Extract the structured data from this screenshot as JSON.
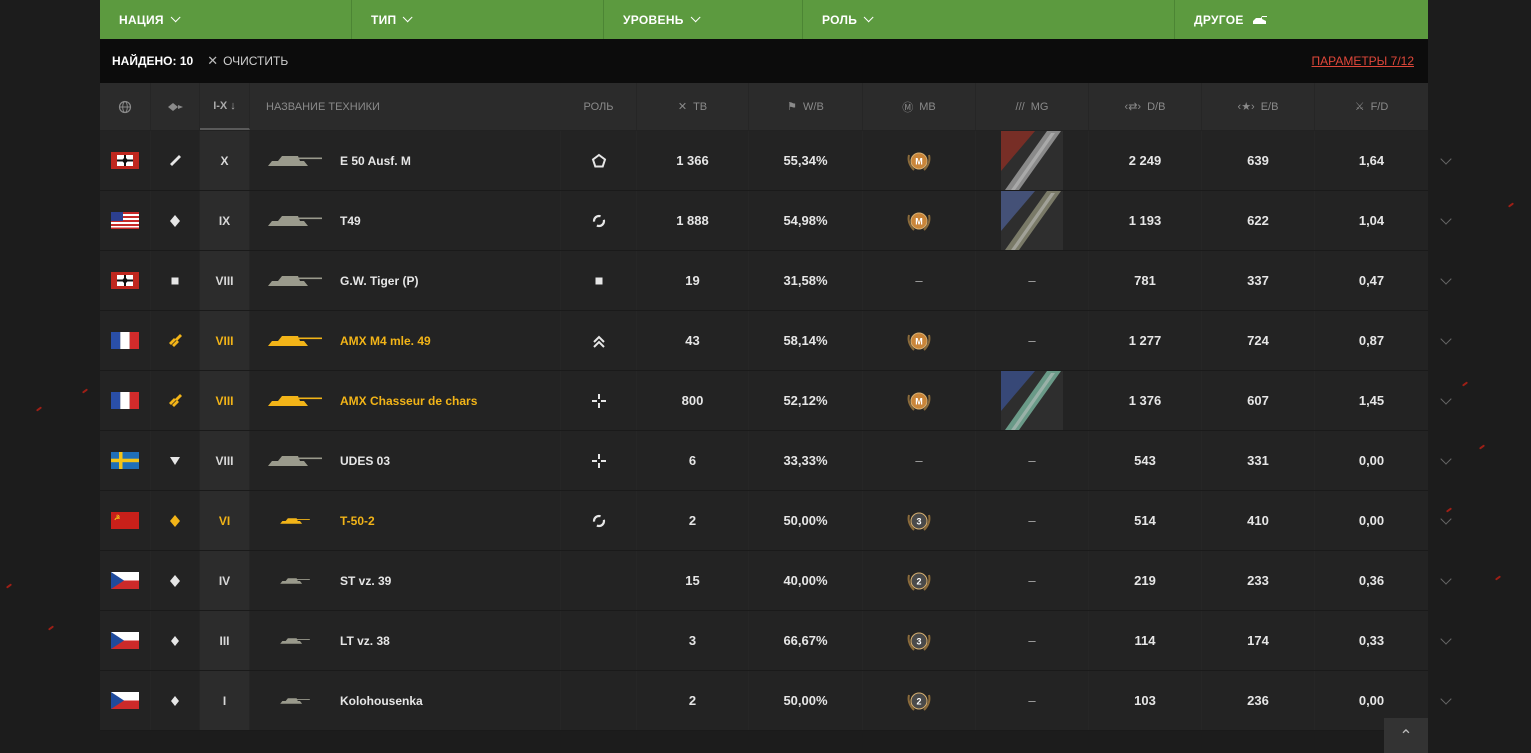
{
  "filters": {
    "nation": "НАЦИЯ",
    "type": "ТИП",
    "level": "УРОВЕНЬ",
    "role": "РОЛЬ",
    "other": "ДРУГОЕ"
  },
  "results": {
    "found": "НАЙДЕНО: 10",
    "clear": "ОЧИСТИТЬ",
    "params": "ПАРАМЕТРЫ 7/12"
  },
  "header": {
    "level": "I-X ↓",
    "name": "НАЗВАНИЕ ТЕХНИКИ",
    "role": "РОЛЬ",
    "tb": "ТВ",
    "wb": "W/B",
    "mb": "MB",
    "mg": "MG",
    "db": "D/B",
    "eb": "E/B",
    "fd": "F/D"
  },
  "colors": {
    "accent_green": "#5c9a3f",
    "premium": "#f2b418",
    "link_red": "#e0473a"
  },
  "rows": [
    {
      "nation": "germany",
      "type": "heavy",
      "level": "X",
      "name": "E 50 Ausf. M",
      "role": "pentagon-icon",
      "tb": "1 366",
      "wb": "55,34%",
      "mb": "mastery-m",
      "mg": "germany",
      "db": "2 249",
      "eb": "639",
      "fd": "1,64",
      "premium": false
    },
    {
      "nation": "usa",
      "type": "medium",
      "level": "IX",
      "name": "T49",
      "role": "cycle-icon",
      "tb": "1 888",
      "wb": "54,98%",
      "mb": "mastery-m",
      "mg": "usa",
      "db": "1 193",
      "eb": "622",
      "fd": "1,04",
      "premium": false
    },
    {
      "nation": "germany",
      "type": "spg",
      "level": "VIII",
      "name": "G.W. Tiger (P)",
      "role": "square-icon",
      "tb": "19",
      "wb": "31,58%",
      "mb": "–",
      "mg": "–",
      "db": "781",
      "eb": "337",
      "fd": "0,47",
      "premium": false
    },
    {
      "nation": "france",
      "type": "heavy",
      "level": "VIII",
      "name": "AMX M4 mle. 49",
      "role": "double-chevron-icon",
      "tb": "43",
      "wb": "58,14%",
      "mb": "mastery-m",
      "mg": "–",
      "db": "1 277",
      "eb": "724",
      "fd": "0,87",
      "premium": true
    },
    {
      "nation": "france",
      "type": "heavy",
      "level": "VIII",
      "name": "AMX Chasseur de chars",
      "role": "crosshair-icon",
      "tb": "800",
      "wb": "52,12%",
      "mb": "mastery-m",
      "mg": "france",
      "db": "1 376",
      "eb": "607",
      "fd": "1,45",
      "premium": true
    },
    {
      "nation": "sweden",
      "type": "td",
      "level": "VIII",
      "name": "UDES 03",
      "role": "crosshair-icon",
      "tb": "6",
      "wb": "33,33%",
      "mb": "–",
      "mg": "–",
      "db": "543",
      "eb": "331",
      "fd": "0,00",
      "premium": false
    },
    {
      "nation": "ussr",
      "type": "medium",
      "level": "VI",
      "name": "T-50-2",
      "role": "cycle-icon",
      "tb": "2",
      "wb": "50,00%",
      "mb": "3",
      "mg": "–",
      "db": "514",
      "eb": "410",
      "fd": "0,00",
      "premium": true
    },
    {
      "nation": "czech",
      "type": "medium",
      "level": "IV",
      "name": "ST vz. 39",
      "role": "",
      "tb": "15",
      "wb": "40,00%",
      "mb": "2",
      "mg": "–",
      "db": "219",
      "eb": "233",
      "fd": "0,36",
      "premium": false
    },
    {
      "nation": "czech",
      "type": "light",
      "level": "III",
      "name": "LT vz. 38",
      "role": "",
      "tb": "3",
      "wb": "66,67%",
      "mb": "3",
      "mg": "–",
      "db": "114",
      "eb": "174",
      "fd": "0,33",
      "premium": false
    },
    {
      "nation": "czech",
      "type": "light",
      "level": "I",
      "name": "Kolohousenka",
      "role": "",
      "tb": "2",
      "wb": "50,00%",
      "mb": "2",
      "mg": "–",
      "db": "103",
      "eb": "236",
      "fd": "0,00",
      "premium": false
    }
  ]
}
